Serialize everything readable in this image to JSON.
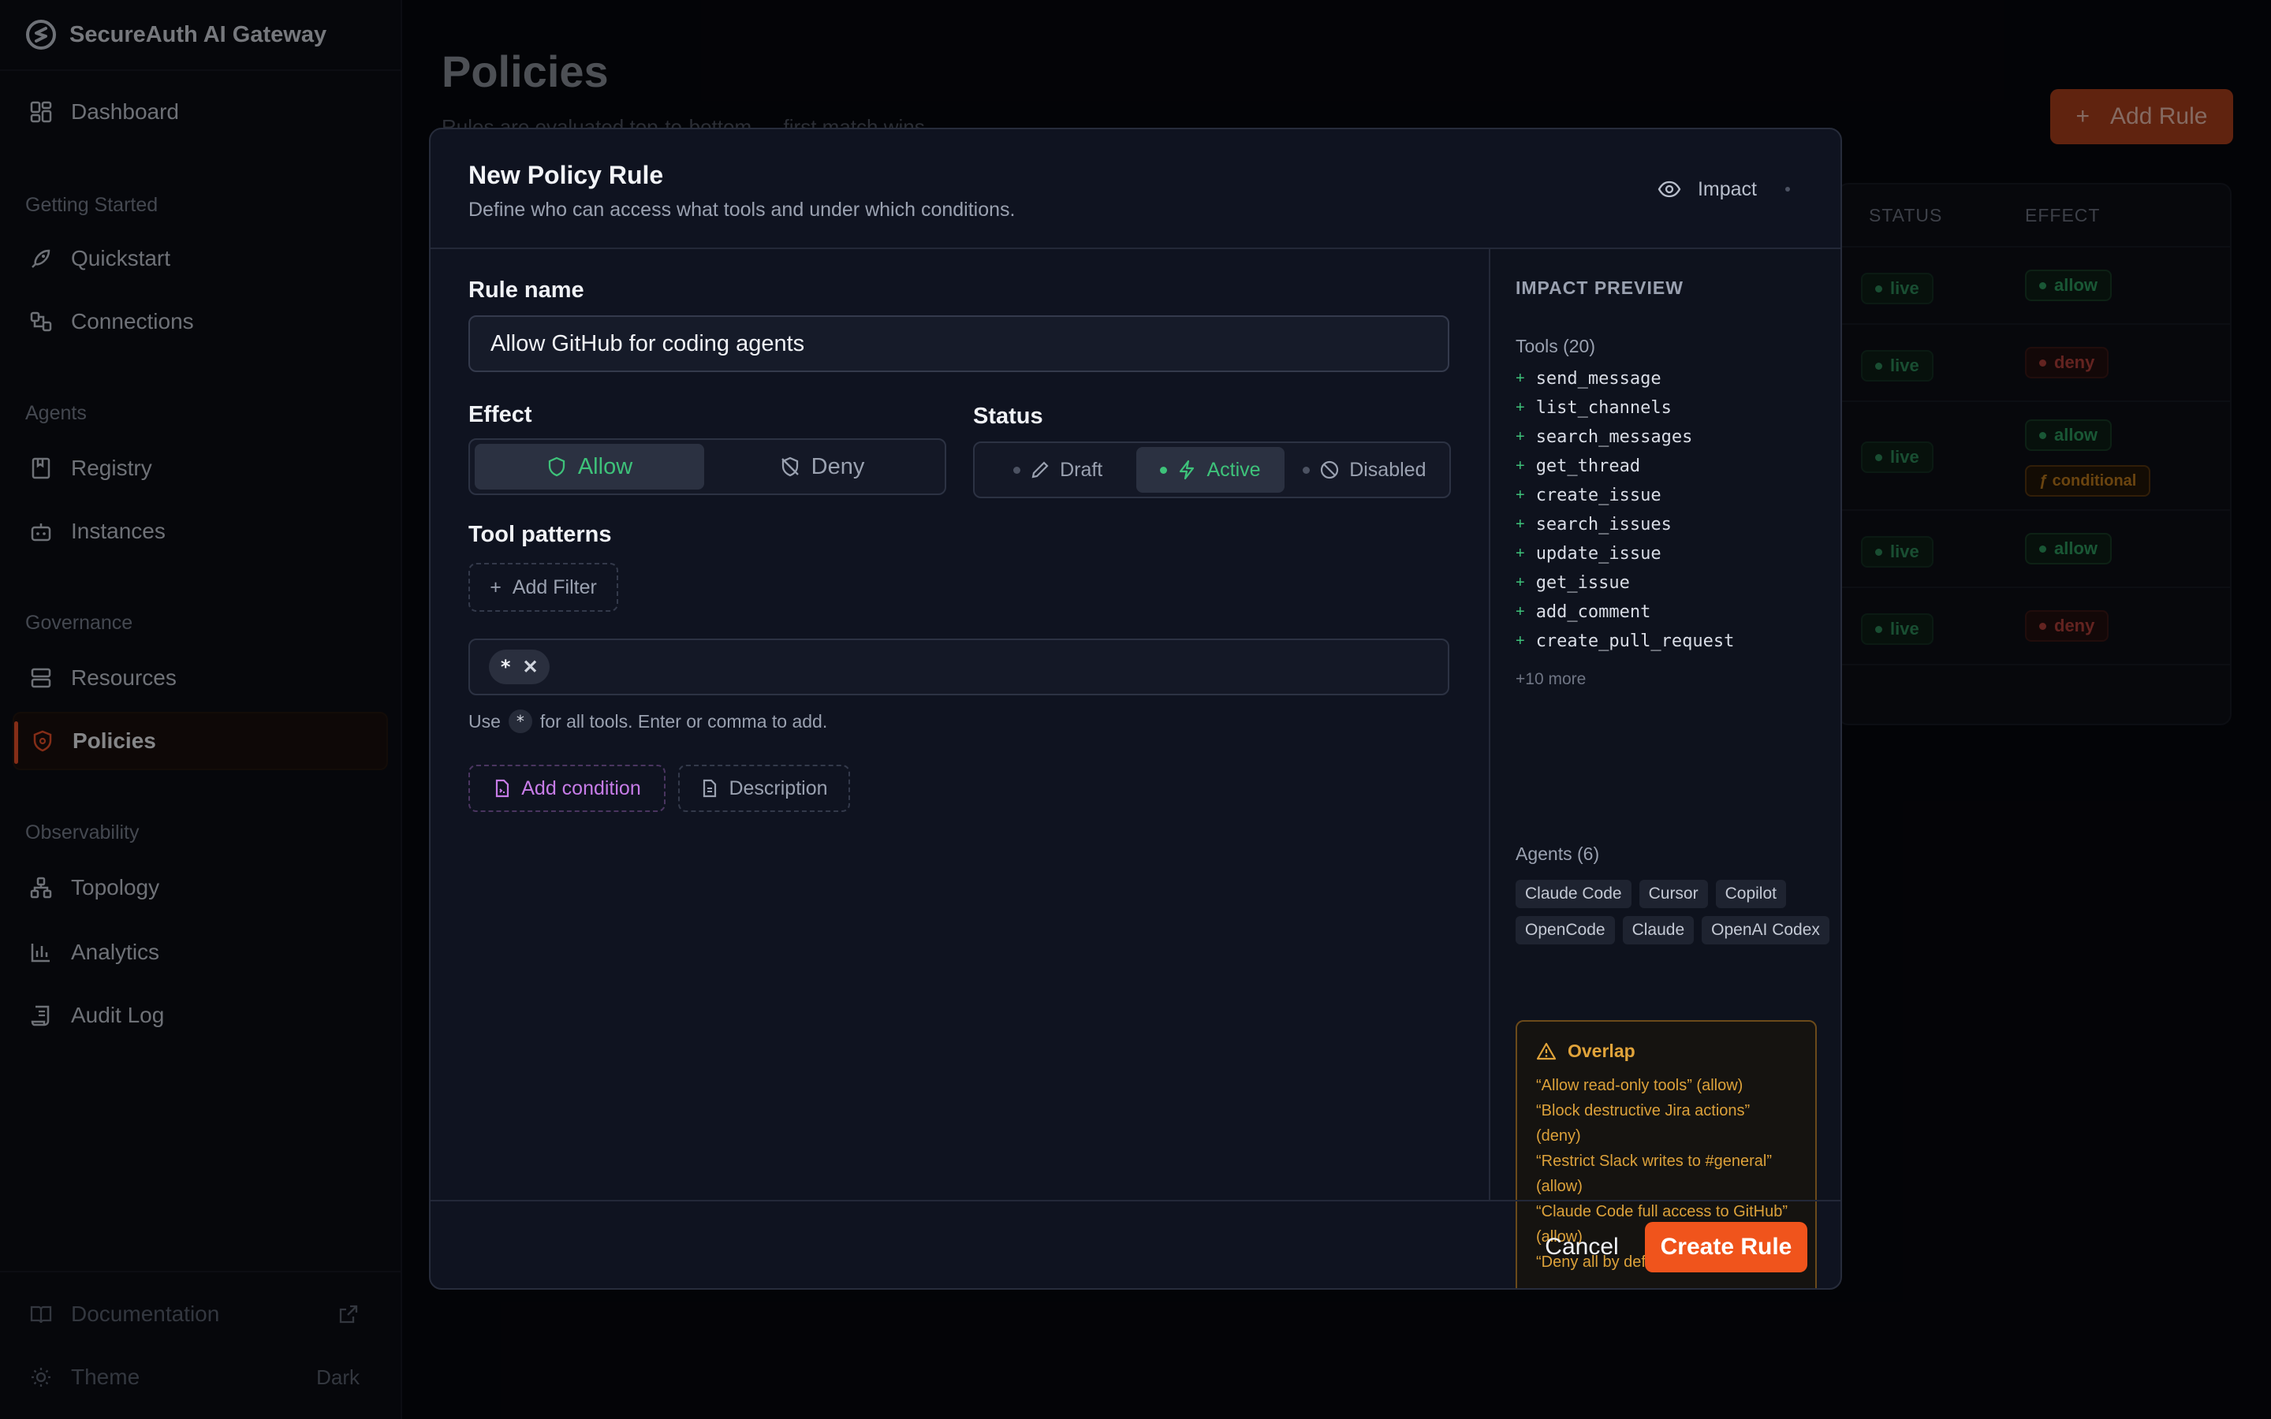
{
  "app": {
    "title": "SecureAuth AI Gateway"
  },
  "sidebar": {
    "dashboard": "Dashboard",
    "sections": {
      "getting_started": "Getting Started",
      "agents": "Agents",
      "governance": "Governance",
      "observability": "Observability"
    },
    "items": {
      "quickstart": "Quickstart",
      "connections": "Connections",
      "registry": "Registry",
      "instances": "Instances",
      "resources": "Resources",
      "policies": "Policies",
      "topology": "Topology",
      "analytics": "Analytics",
      "audit_log": "Audit Log"
    },
    "footer": {
      "documentation": "Documentation",
      "theme_label": "Theme",
      "theme_value": "Dark"
    }
  },
  "page": {
    "title": "Policies",
    "subtitle": "Rules are evaluated top-to-bottom — first match wins",
    "add_rule": "Add Rule",
    "table": {
      "col_status": "STATUS",
      "col_effect": "EFFECT",
      "rows": [
        {
          "status": "live",
          "effect": "allow"
        },
        {
          "status": "live",
          "effect": "deny"
        },
        {
          "status": "live",
          "effect": "allow",
          "extra": "ƒ conditional"
        },
        {
          "status": "live",
          "effect": "allow"
        },
        {
          "status": "live",
          "effect": "deny"
        }
      ]
    }
  },
  "modal": {
    "title": "New Policy Rule",
    "description": "Define who can access what tools and under which conditions.",
    "impact_toggle": "Impact",
    "rule_name_label": "Rule name",
    "rule_name_value": "Allow GitHub for coding agents",
    "effect_label": "Effect",
    "effect_allow": "Allow",
    "effect_deny": "Deny",
    "status_label": "Status",
    "status_draft": "Draft",
    "status_active": "Active",
    "status_disabled": "Disabled",
    "tool_patterns_label": "Tool patterns",
    "add_filter": "Add Filter",
    "pattern_chip": "*",
    "hint_prefix": "Use",
    "hint_kbd": "*",
    "hint_suffix": "for all tools. Enter or comma to add.",
    "add_condition": "Add condition",
    "description_btn": "Description",
    "cancel": "Cancel",
    "create": "Create Rule"
  },
  "impact": {
    "title": "IMPACT PREVIEW",
    "tools_label": "Tools (20)",
    "tools": [
      "send_message",
      "list_channels",
      "search_messages",
      "get_thread",
      "create_issue",
      "search_issues",
      "update_issue",
      "get_issue",
      "add_comment",
      "create_pull_request"
    ],
    "more": "+10 more",
    "agents_label": "Agents (6)",
    "agents": [
      "Claude Code",
      "Cursor",
      "Copilot",
      "OpenCode",
      "Claude",
      "OpenAI Codex"
    ],
    "overlap_title": "Overlap",
    "overlaps": [
      "“Allow read-only tools” (allow)",
      "“Block destructive Jira actions” (deny)",
      "“Restrict Slack writes to #general” (allow)",
      "“Claude Code full access to GitHub” (allow)",
      "“Deny all by default” (deny)"
    ]
  },
  "colors": {
    "accent": "#f0541c",
    "allow": "#3ec27a",
    "deny": "#b5413b",
    "warning": "#dca13a"
  }
}
